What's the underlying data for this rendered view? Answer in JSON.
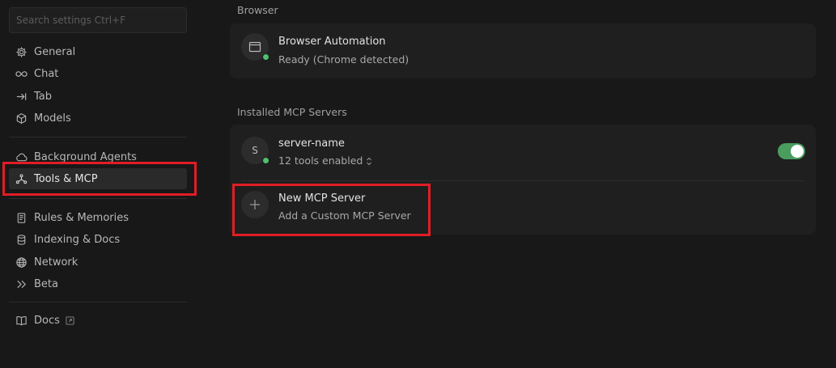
{
  "search": {
    "placeholder": "Search settings Ctrl+F",
    "value": ""
  },
  "sidebar": {
    "items": [
      {
        "label": "General",
        "icon": "gear-icon"
      },
      {
        "label": "Chat",
        "icon": "infinity-icon"
      },
      {
        "label": "Tab",
        "icon": "tab-arrow-icon"
      },
      {
        "label": "Models",
        "icon": "cube-icon"
      },
      {
        "label": "Background Agents",
        "icon": "cloud-icon"
      },
      {
        "label": "Tools & MCP",
        "icon": "tools-nodes-icon",
        "active": true
      },
      {
        "label": "Rules & Memories",
        "icon": "document-icon"
      },
      {
        "label": "Indexing & Docs",
        "icon": "database-icon"
      },
      {
        "label": "Network",
        "icon": "globe-icon"
      },
      {
        "label": "Beta",
        "icon": "double-chevron-icon"
      },
      {
        "label": "Docs",
        "icon": "book-icon",
        "external": true
      }
    ]
  },
  "browser": {
    "section_label": "Browser",
    "automation": {
      "title": "Browser Automation",
      "status": "Ready (Chrome detected)"
    }
  },
  "mcp": {
    "section_label": "Installed MCP Servers",
    "servers": [
      {
        "avatar_letter": "S",
        "name": "server-name",
        "tools": "12 tools enabled",
        "enabled": true
      }
    ],
    "new_server": {
      "title": "New MCP Server",
      "subtitle": "Add a Custom MCP Server"
    }
  },
  "colors": {
    "status_green": "#4ec26f",
    "toggle_on": "#4a9c5f",
    "highlight": "#e11d25",
    "background": "#181818",
    "card": "#1f1f1f"
  }
}
